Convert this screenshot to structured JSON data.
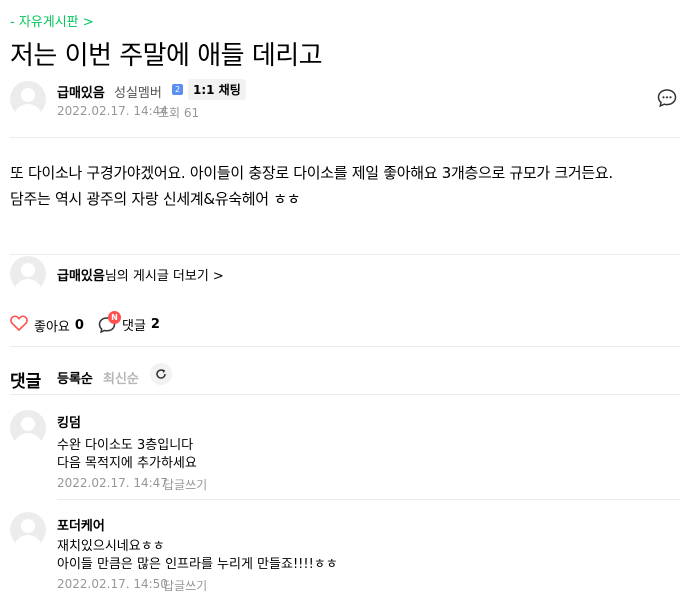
{
  "board": {
    "link": "- 자유게시판 >"
  },
  "post": {
    "title": "저는 이번 주말에 애들 데리고",
    "author": {
      "nick": "급매있음",
      "grade": "성실멤버",
      "grade_icon": "2",
      "chat_button": "1:1 채팅"
    },
    "date": "2022.02.17. 14:44",
    "views": "조회 61",
    "body_lines": [
      "또 다이소나 구경가야겠어요. 아이들이 충장로 다이소를 제일 좋아해요 3개층으로 규모가 크거든요.",
      "담주는 역시 광주의 자랑 신세계&유숙헤어 ㅎㅎ"
    ]
  },
  "footer": {
    "more_nick": "급매있음",
    "more_suffix": "님의 게시글 더보기 >",
    "like_label": "좋아요",
    "like_count": "0",
    "comment_label": "댓글",
    "comment_count": "2",
    "new_badge": "N"
  },
  "comments_section": {
    "heading": "댓글",
    "sort_register": "등록순",
    "sort_latest": "최신순"
  },
  "comments": [
    {
      "nick": "킹덤",
      "lines": [
        "수완 다이소도 3층입니다",
        "다음 목적지에 추가하세요"
      ],
      "date": "2022.02.17. 14:47",
      "reply": "답글쓰기"
    },
    {
      "nick": "포더케어",
      "lines": [
        "재치있으시네요ㅎㅎ",
        "아이들 만큼은 많은 인프라를 누리게 만들죠!!!!ㅎㅎ"
      ],
      "date": "2022.02.17. 14:50",
      "reply": "답글쓰기"
    }
  ],
  "colors": {
    "accent": "#03c75a",
    "heart": "#ff4f4f",
    "muted": "#979797",
    "badge": "#ff4f4f"
  }
}
